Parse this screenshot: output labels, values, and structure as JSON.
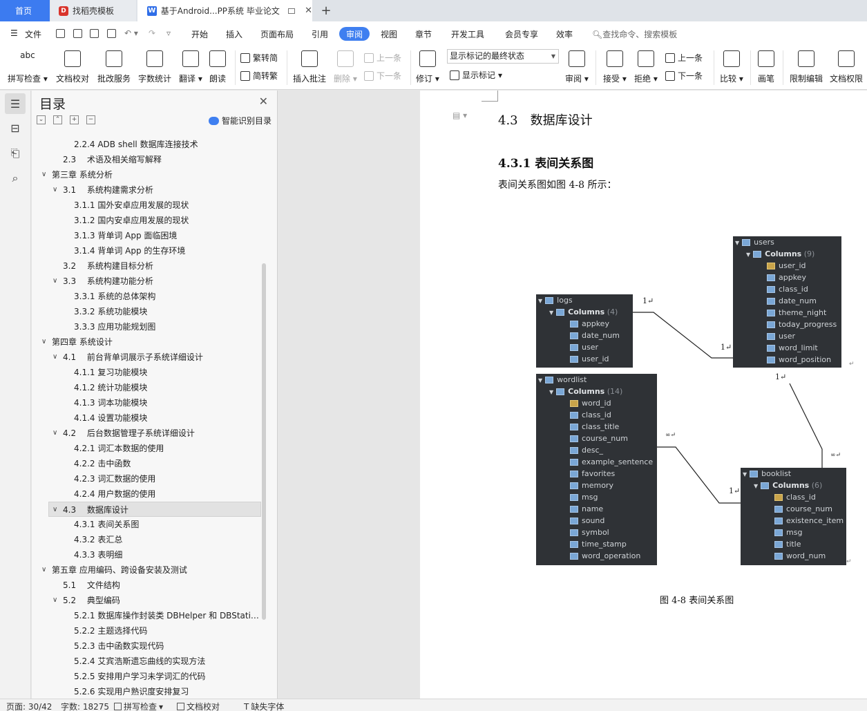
{
  "tabs": [
    {
      "label": "首页"
    },
    {
      "label": "找稻壳模板"
    },
    {
      "label": "基于Android...PP系统 毕业论文"
    }
  ],
  "menu": {
    "file": "文件",
    "items": [
      "开始",
      "插入",
      "页面布局",
      "引用",
      "审阅",
      "视图",
      "章节",
      "开发工具",
      "会员专享",
      "效率"
    ],
    "active": "审阅",
    "search": "查找命令、搜索模板"
  },
  "ribbon": {
    "spell": "拼写检查",
    "doc_check": "文档校对",
    "batch": "批改服务",
    "word_count": "字数统计",
    "translate": "翻译",
    "read_aloud": "朗读",
    "to_trad": "繁转简",
    "to_simp": "简转繁",
    "insert_comment": "插入批注",
    "delete": "删除",
    "prev_comment": "上一条",
    "next_comment": "下一条",
    "revise": "修订",
    "markup_state": "显示标记的最终状态",
    "show_markup": "显示标记",
    "review": "审阅",
    "accept": "接受",
    "reject": "拒绝",
    "prev_change": "上一条",
    "next_change": "下一条",
    "compare": "比较",
    "pen": "画笔",
    "restrict": "限制编辑",
    "doc_rights": "文档权限"
  },
  "toc": {
    "title": "目录",
    "smart": "智能识别目录",
    "items": [
      {
        "label": "2.2.4 ADB shell 数据库连接技术",
        "level": 3,
        "chev": ""
      },
      {
        "label": "2.3　 术语及相关缩写解释",
        "level": 2,
        "chev": ""
      },
      {
        "label": "第三章  系统分析",
        "level": 1,
        "chev": "v"
      },
      {
        "label": "3.1　 系统构建需求分析",
        "level": 2,
        "chev": "v"
      },
      {
        "label": "3.1.1  国外安卓应用发展的现状",
        "level": 3,
        "chev": ""
      },
      {
        "label": "3.1.2  国内安卓应用发展的现状",
        "level": 3,
        "chev": ""
      },
      {
        "label": "3.1.3  背单词 App 面临困境",
        "level": 3,
        "chev": ""
      },
      {
        "label": "3.1.4  背单词 App 的生存环境",
        "level": 3,
        "chev": ""
      },
      {
        "label": "3.2　 系统构建目标分析",
        "level": 2,
        "chev": ""
      },
      {
        "label": "3.3　 系统构建功能分析",
        "level": 2,
        "chev": "v"
      },
      {
        "label": "3.3.1  系统的总体架构",
        "level": 3,
        "chev": ""
      },
      {
        "label": "3.3.2  系统功能模块",
        "level": 3,
        "chev": ""
      },
      {
        "label": "3.3.3  应用功能规划图",
        "level": 3,
        "chev": ""
      },
      {
        "label": "第四章  系统设计",
        "level": 1,
        "chev": "v"
      },
      {
        "label": "4.1　 前台背单词展示子系统详细设计",
        "level": 2,
        "chev": "v"
      },
      {
        "label": "4.1.1  复习功能模块",
        "level": 3,
        "chev": ""
      },
      {
        "label": "4.1.2  统计功能模块",
        "level": 3,
        "chev": ""
      },
      {
        "label": "4.1.3  词本功能模块",
        "level": 3,
        "chev": ""
      },
      {
        "label": "4.1.4  设置功能模块",
        "level": 3,
        "chev": ""
      },
      {
        "label": "4.2　 后台数据管理子系统详细设计",
        "level": 2,
        "chev": "v"
      },
      {
        "label": "4.2.1 词汇本数据的使用",
        "level": 3,
        "chev": ""
      },
      {
        "label": "4.2.2 击中函数",
        "level": 3,
        "chev": ""
      },
      {
        "label": "4.2.3 词汇数据的使用",
        "level": 3,
        "chev": ""
      },
      {
        "label": "4.2.4  用户数据的使用",
        "level": 3,
        "chev": ""
      },
      {
        "label": "4.3　 数据库设计",
        "level": 2,
        "chev": "v",
        "selected": true
      },
      {
        "label": "4.3.1  表间关系图",
        "level": 3,
        "chev": ""
      },
      {
        "label": "4.3.2  表汇总",
        "level": 3,
        "chev": ""
      },
      {
        "label": "4.3.3  表明细",
        "level": 3,
        "chev": ""
      },
      {
        "label": "第五章  应用编码、跨设备安装及测试",
        "level": 1,
        "chev": "v"
      },
      {
        "label": "5.1　 文件结构",
        "level": 2,
        "chev": ""
      },
      {
        "label": "5.2　 典型编码",
        "level": 2,
        "chev": "v"
      },
      {
        "label": "5.2.1  数据库操作封装类 DBHelper 和 DBStati…",
        "level": 3,
        "chev": ""
      },
      {
        "label": "5.2.2  主题选择代码",
        "level": 3,
        "chev": ""
      },
      {
        "label": "5.2.3  击中函数实现代码",
        "level": 3,
        "chev": ""
      },
      {
        "label": "5.2.4 艾宾浩斯遗忘曲线的实现方法",
        "level": 3,
        "chev": ""
      },
      {
        "label": "5.2.5 安排用户学习未学词汇的代码",
        "level": 3,
        "chev": ""
      },
      {
        "label": "5.2.6  实现用户熟识度安排复习",
        "level": 3,
        "chev": ""
      }
    ]
  },
  "doc": {
    "h2": "4.3　数据库设计",
    "h3": "4.3.1  表间关系图",
    "body": "表间关系图如图 4-8 所示：",
    "caption": "图 4-8  表间关系图"
  },
  "er": {
    "columns_label": "Columns",
    "users": {
      "name": "users",
      "count": "(9)",
      "fields": [
        "user_id",
        "appkey",
        "class_id",
        "date_num",
        "theme_night",
        "today_progress",
        "user",
        "word_limit",
        "word_position"
      ]
    },
    "logs": {
      "name": "logs",
      "count": "(4)",
      "fields": [
        "appkey",
        "date_num",
        "user",
        "user_id"
      ]
    },
    "wordlist": {
      "name": "wordlist",
      "count": "(14)",
      "fields": [
        "word_id",
        "class_id",
        "class_title",
        "course_num",
        "desc_",
        "example_sentence",
        "favorites",
        "memory",
        "msg",
        "name",
        "sound",
        "symbol",
        "time_stamp",
        "word_operation"
      ]
    },
    "booklist": {
      "name": "booklist",
      "count": "(6)",
      "fields": [
        "class_id",
        "course_num",
        "existence_item",
        "msg",
        "title",
        "word_num"
      ]
    },
    "card_one": "1",
    "card_many": "∞"
  },
  "status": {
    "page": "页面: 30/42",
    "words": "字数: 18275",
    "spell": "拼写检查",
    "doc_check": "文档校对",
    "missing_font": "缺失字体"
  }
}
